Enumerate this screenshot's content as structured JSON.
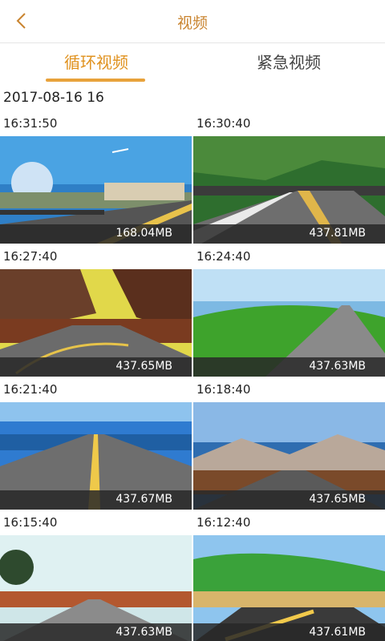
{
  "header": {
    "title": "视频",
    "back_icon": "chevron-left-icon",
    "accent": "#c9842f"
  },
  "tabs": [
    {
      "label": "循环视频",
      "active": true
    },
    {
      "label": "紧急视频",
      "active": false
    }
  ],
  "date_group": "2017-08-16 16",
  "videos": [
    {
      "time": "16:31:50",
      "size": "168.04MB"
    },
    {
      "time": "16:30:40",
      "size": "437.81MB"
    },
    {
      "time": "16:27:40",
      "size": "437.65MB"
    },
    {
      "time": "16:24:40",
      "size": "437.63MB"
    },
    {
      "time": "16:21:40",
      "size": "437.67MB"
    },
    {
      "time": "16:18:40",
      "size": "437.65MB"
    },
    {
      "time": "16:15:40",
      "size": "437.63MB"
    },
    {
      "time": "16:12:40",
      "size": "437.61MB"
    }
  ]
}
